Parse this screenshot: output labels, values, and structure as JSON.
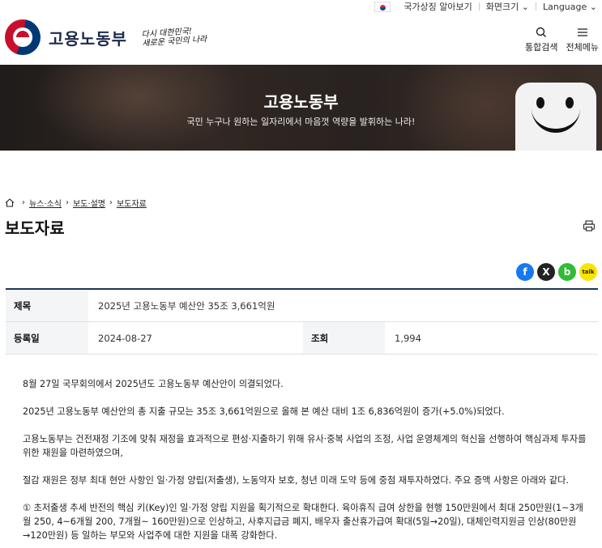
{
  "utility": {
    "national_symbol": "국가상징 알아보기",
    "screen_size": "화면크기",
    "language": "Language"
  },
  "header": {
    "logo_text": "고용노동부",
    "slogan_line1": "다시 대한민국!",
    "slogan_line2": "새로운 국민의 나라",
    "search_label": "통합검색",
    "menu_label": "전체메뉴"
  },
  "banner": {
    "title": "고용노동부",
    "subtitle": "국민 누구나 원하는 일자리에서 마음껏 역량을 발휘하는 나라!"
  },
  "breadcrumb": [
    "뉴스·소식",
    "보도·설명",
    "보도자료"
  ],
  "page_title": "보도자료",
  "article": {
    "title_label": "제목",
    "title_value": "2025년 고용노동부 예산안 35조 3,661억원",
    "date_label": "등록일",
    "date_value": "2024-08-27",
    "views_label": "조회",
    "views_value": "1,994"
  },
  "share": {
    "facebook": "f",
    "x": "X",
    "band": "b",
    "kakao": "talk"
  },
  "body": [
    "8월 27일 국무회의에서 2025년도 고용노동부 예산안이 의결되었다.",
    "2025년 고용노동부 예산안의 총 지출 규모는 35조 3,661억원으로 올해 본 예산 대비 1조 6,836억원이 증가(+5.0%)되었다.",
    "고용노동부는 건전재정 기조에 맞춰 재정을 효과적으로 편성·지출하기 위해 유사·중복 사업의 조정, 사업 운영체계의 혁신을 선행하여 핵심과제 투자를 위한 재원을 마련하였으며,",
    "절감 재원은 정부 최대 현안 사항인 일·가정 양립(저출생), 노동약자 보호, 청년 미래 도약 등에 중점 재투자하였다. 주요 증액 사항은 아래와 같다.",
    "① 초저출생 추세 반전의 핵심 키(Key)인 일·가정 양립 지원을 획기적으로 확대한다. 육아휴직 급여 상한을 현행 150만원에서 최대 250만원(1~3개월 250, 4~6개월 200, 7개월~ 160만원)으로 인상하고, 사후지급금 폐지, 배우자 출산휴가급여 확대(5일→20일), 대체인력지원금 인상(80만원→120만원) 등 일하는 부모와 사업주에 대한 지원을 대폭 강화한다."
  ]
}
